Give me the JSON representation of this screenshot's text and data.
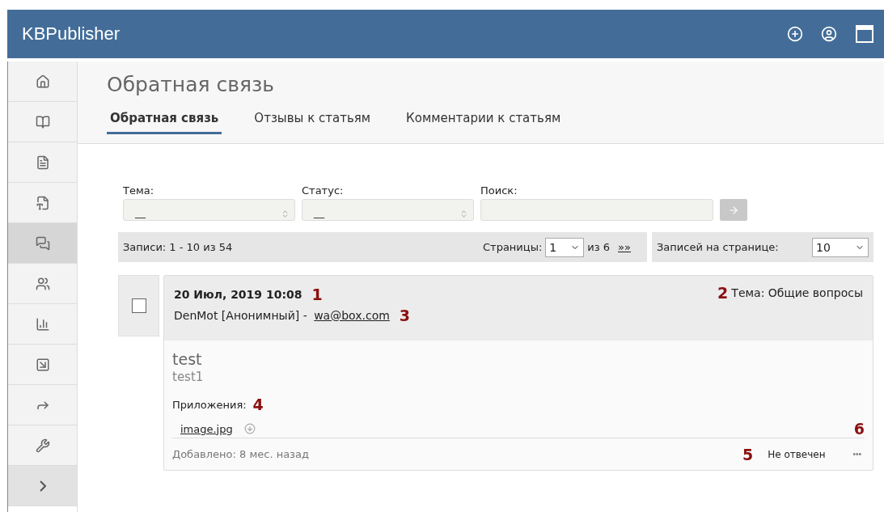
{
  "header": {
    "title": "KBPublisher"
  },
  "sidebar": {
    "items": [
      {
        "selected": false
      },
      {
        "selected": false
      },
      {
        "selected": false
      },
      {
        "selected": false
      },
      {
        "selected": true
      },
      {
        "selected": false
      },
      {
        "selected": false
      },
      {
        "selected": false
      },
      {
        "selected": false
      },
      {
        "selected": false
      },
      {
        "selected": false
      }
    ]
  },
  "page": {
    "title": "Обратная связь"
  },
  "tabs": [
    {
      "label": "Обратная связь",
      "selected": true
    },
    {
      "label": "Отзывы к статьям",
      "selected": false
    },
    {
      "label": "Комментарии к статьям",
      "selected": false
    }
  ],
  "filters": [
    {
      "kind": "select",
      "label": "Тема:",
      "value": "__"
    },
    {
      "kind": "select",
      "label": "Статус:",
      "value": "__"
    },
    {
      "kind": "search",
      "label": "Поиск:"
    }
  ],
  "pager": {
    "records": "Записи: 1 - 10 из 54",
    "pages_label": "Страницы:",
    "page": "1",
    "of": "из 6",
    "next": "»»",
    "per_page_label": "Записей на странице:",
    "per_page": "10"
  },
  "entries": [
    {
      "checked": false,
      "date": "20 Июл, 2019 10:08",
      "author": "DenMot [Анонимный] - ",
      "email": "wa@box.com",
      "topic": "Тема: Общие вопросы",
      "subject": "test",
      "body": "test1",
      "attachments_label": "Приложения:",
      "attachments": [
        "image.jpg"
      ],
      "added": "Добавлено: 8 мес. назад",
      "status": "Не отвечен",
      "more": "•••",
      "markers": [
        "1",
        "2",
        "3",
        "4",
        "5",
        "6"
      ]
    }
  ]
}
